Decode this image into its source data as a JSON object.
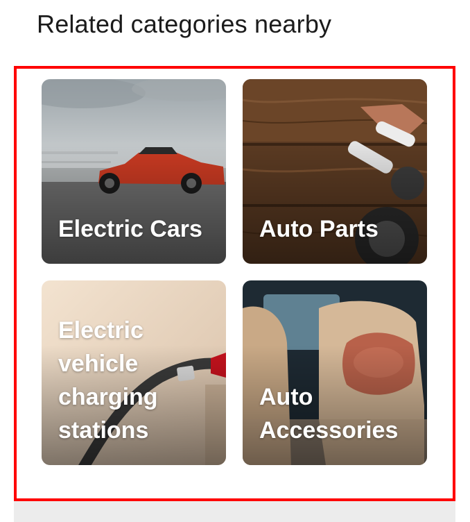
{
  "section": {
    "title": "Related categories nearby"
  },
  "categories": [
    {
      "label": "Electric Cars",
      "image": "red-sports-car-photo"
    },
    {
      "label": "Auto Parts",
      "image": "spark-plugs-on-wood-photo"
    },
    {
      "label": "Electric vehicle charging stations",
      "image": "ev-charger-plug-photo"
    },
    {
      "label": "Auto Accessories",
      "image": "car-seat-pillow-photo"
    }
  ],
  "colors": {
    "highlight": "#ff0000",
    "label_text": "#ffffff"
  }
}
